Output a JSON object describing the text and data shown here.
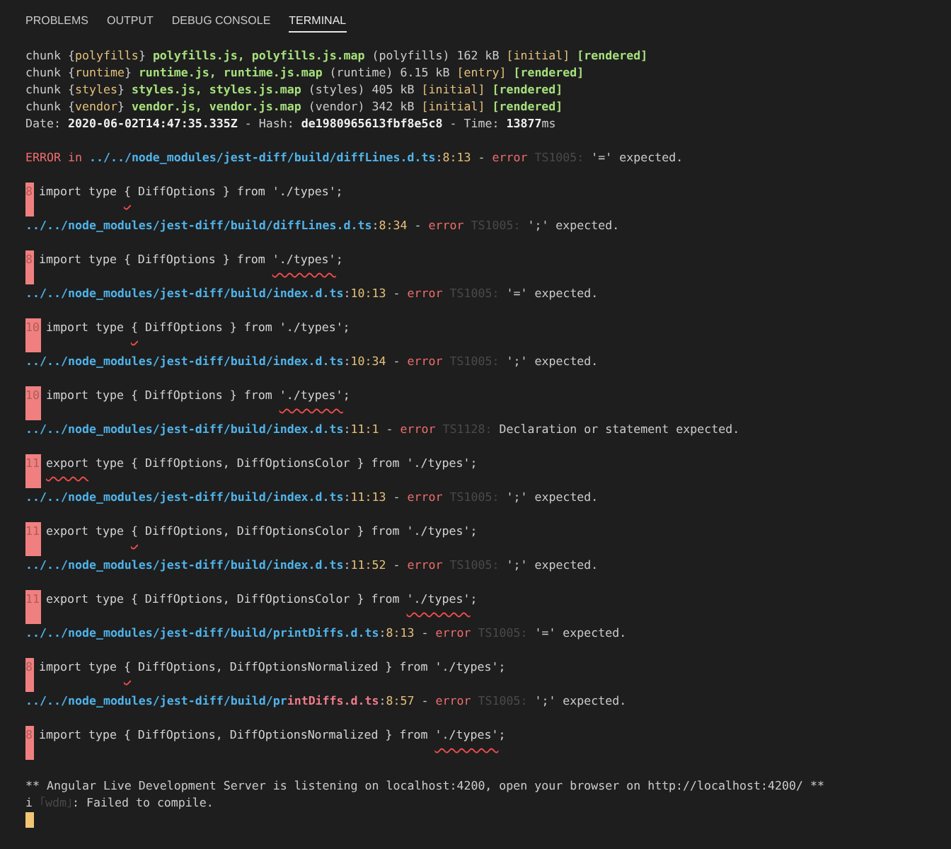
{
  "panel_tabs": [
    {
      "label": "PROBLEMS",
      "selected": false
    },
    {
      "label": "OUTPUT",
      "selected": false
    },
    {
      "label": "DEBUG CONSOLE",
      "selected": false
    },
    {
      "label": "TERMINAL",
      "selected": true
    }
  ],
  "terminal": {
    "lines": [
      {
        "kind": "text",
        "segments": [
          {
            "text": "chunk {",
            "kind": "normal"
          },
          {
            "text": "polyfills",
            "kind": "label"
          },
          {
            "text": "} ",
            "kind": "normal"
          },
          {
            "text": "polyfills.js, polyfills.js.map",
            "kind": "asset"
          },
          {
            "text": " (polyfills) 162 kB ",
            "kind": "normal"
          },
          {
            "text": "[initial] ",
            "kind": "label"
          },
          {
            "text": "[rendered]",
            "kind": "asset"
          }
        ]
      },
      {
        "kind": "text",
        "segments": [
          {
            "text": "chunk {",
            "kind": "normal"
          },
          {
            "text": "runtime",
            "kind": "label"
          },
          {
            "text": "} ",
            "kind": "normal"
          },
          {
            "text": "runtime.js, runtime.js.map",
            "kind": "asset"
          },
          {
            "text": " (runtime) 6.15 kB ",
            "kind": "normal"
          },
          {
            "text": "[entry] ",
            "kind": "label"
          },
          {
            "text": "[rendered]",
            "kind": "asset"
          }
        ]
      },
      {
        "kind": "text",
        "segments": [
          {
            "text": "chunk {",
            "kind": "normal"
          },
          {
            "text": "styles",
            "kind": "label"
          },
          {
            "text": "} ",
            "kind": "normal"
          },
          {
            "text": "styles.js, styles.js.map",
            "kind": "asset"
          },
          {
            "text": " (styles) 405 kB ",
            "kind": "normal"
          },
          {
            "text": "[initial] ",
            "kind": "label"
          },
          {
            "text": "[rendered]",
            "kind": "asset"
          }
        ]
      },
      {
        "kind": "text",
        "segments": [
          {
            "text": "chunk {",
            "kind": "normal"
          },
          {
            "text": "vendor",
            "kind": "label"
          },
          {
            "text": "} ",
            "kind": "normal"
          },
          {
            "text": "vendor.js, vendor.js.map",
            "kind": "asset"
          },
          {
            "text": " (vendor) 342 kB ",
            "kind": "normal"
          },
          {
            "text": "[initial] ",
            "kind": "label"
          },
          {
            "text": "[rendered]",
            "kind": "asset"
          }
        ]
      },
      {
        "kind": "text",
        "segments": [
          {
            "text": "Date: ",
            "kind": "normal"
          },
          {
            "text": "2020-06-02T14:47:35.335Z",
            "kind": "value"
          },
          {
            "text": " - Hash: ",
            "kind": "normal"
          },
          {
            "text": "de1980965613fbf8e5c8",
            "kind": "value"
          },
          {
            "text": " - Time: ",
            "kind": "normal"
          },
          {
            "text": "13877",
            "kind": "value"
          },
          {
            "text": "ms",
            "kind": "normal"
          }
        ]
      },
      {
        "kind": "blank"
      },
      {
        "kind": "text",
        "segments": [
          {
            "text": "ERROR in ",
            "kind": "error"
          },
          {
            "text": "../../node_modules/jest-diff/build/diffLines.d.ts",
            "kind": "path"
          },
          {
            "text": ":",
            "kind": "normal"
          },
          {
            "text": "8:13",
            "kind": "label"
          },
          {
            "text": " - ",
            "kind": "normal"
          },
          {
            "text": "error",
            "kind": "error"
          },
          {
            "text": " TS1005: ",
            "kind": "code"
          },
          {
            "text": "'=' expected.",
            "kind": "normal"
          }
        ]
      },
      {
        "kind": "blank"
      },
      {
        "kind": "code",
        "line_number": "8",
        "segments": [
          {
            "text": "import type ",
            "squiggle": false
          },
          {
            "text": "{",
            "squiggle": true
          },
          {
            "text": " DiffOptions } from './types';",
            "squiggle": false
          }
        ]
      },
      {
        "kind": "text",
        "segments": [
          {
            "text": "../../node_modules/jest-diff/build/diffLines.d.ts",
            "kind": "path"
          },
          {
            "text": ":",
            "kind": "normal"
          },
          {
            "text": "8:34",
            "kind": "label"
          },
          {
            "text": " - ",
            "kind": "normal"
          },
          {
            "text": "error",
            "kind": "error"
          },
          {
            "text": " TS1005: ",
            "kind": "code"
          },
          {
            "text": "';' expected.",
            "kind": "normal"
          }
        ]
      },
      {
        "kind": "blank"
      },
      {
        "kind": "code",
        "line_number": "8",
        "segments": [
          {
            "text": "import type { DiffOptions } from ",
            "squiggle": false
          },
          {
            "text": "'./types'",
            "squiggle": true
          },
          {
            "text": ";",
            "squiggle": false
          }
        ]
      },
      {
        "kind": "text",
        "segments": [
          {
            "text": "../../node_modules/jest-diff/build/index.d.ts",
            "kind": "path"
          },
          {
            "text": ":",
            "kind": "normal"
          },
          {
            "text": "10:13",
            "kind": "label"
          },
          {
            "text": " - ",
            "kind": "normal"
          },
          {
            "text": "error",
            "kind": "error"
          },
          {
            "text": " TS1005: ",
            "kind": "code"
          },
          {
            "text": "'=' expected.",
            "kind": "normal"
          }
        ]
      },
      {
        "kind": "blank"
      },
      {
        "kind": "code",
        "line_number": "10",
        "segments": [
          {
            "text": "import type ",
            "squiggle": false
          },
          {
            "text": "{",
            "squiggle": true
          },
          {
            "text": " DiffOptions } from './types';",
            "squiggle": false
          }
        ]
      },
      {
        "kind": "text",
        "segments": [
          {
            "text": "../../node_modules/jest-diff/build/index.d.ts",
            "kind": "path"
          },
          {
            "text": ":",
            "kind": "normal"
          },
          {
            "text": "10:34",
            "kind": "label"
          },
          {
            "text": " - ",
            "kind": "normal"
          },
          {
            "text": "error",
            "kind": "error"
          },
          {
            "text": " TS1005: ",
            "kind": "code"
          },
          {
            "text": "';' expected.",
            "kind": "normal"
          }
        ]
      },
      {
        "kind": "blank"
      },
      {
        "kind": "code",
        "line_number": "10",
        "segments": [
          {
            "text": "import type { DiffOptions } from ",
            "squiggle": false
          },
          {
            "text": "'./types'",
            "squiggle": true
          },
          {
            "text": ";",
            "squiggle": false
          }
        ]
      },
      {
        "kind": "text",
        "segments": [
          {
            "text": "../../node_modules/jest-diff/build/index.d.ts",
            "kind": "path"
          },
          {
            "text": ":",
            "kind": "normal"
          },
          {
            "text": "11:1",
            "kind": "label"
          },
          {
            "text": " - ",
            "kind": "normal"
          },
          {
            "text": "error",
            "kind": "error"
          },
          {
            "text": " TS1128: ",
            "kind": "code"
          },
          {
            "text": "Declaration or statement expected.",
            "kind": "normal"
          }
        ]
      },
      {
        "kind": "blank"
      },
      {
        "kind": "code",
        "line_number": "11",
        "segments": [
          {
            "text": "export",
            "squiggle": true
          },
          {
            "text": " type { DiffOptions, DiffOptionsColor } from './types';",
            "squiggle": false
          }
        ]
      },
      {
        "kind": "text",
        "segments": [
          {
            "text": "../../node_modules/jest-diff/build/index.d.ts",
            "kind": "path"
          },
          {
            "text": ":",
            "kind": "normal"
          },
          {
            "text": "11:13",
            "kind": "label"
          },
          {
            "text": " - ",
            "kind": "normal"
          },
          {
            "text": "error",
            "kind": "error"
          },
          {
            "text": " TS1005: ",
            "kind": "code"
          },
          {
            "text": "';' expected.",
            "kind": "normal"
          }
        ]
      },
      {
        "kind": "blank"
      },
      {
        "kind": "code",
        "line_number": "11",
        "segments": [
          {
            "text": "export type ",
            "squiggle": false
          },
          {
            "text": "{",
            "squiggle": true
          },
          {
            "text": " DiffOptions, DiffOptionsColor } from './types';",
            "squiggle": false
          }
        ]
      },
      {
        "kind": "text",
        "segments": [
          {
            "text": "../../node_modules/jest-diff/build/index.d.ts",
            "kind": "path"
          },
          {
            "text": ":",
            "kind": "normal"
          },
          {
            "text": "11:52",
            "kind": "label"
          },
          {
            "text": " - ",
            "kind": "normal"
          },
          {
            "text": "error",
            "kind": "error"
          },
          {
            "text": " TS1005: ",
            "kind": "code"
          },
          {
            "text": "';' expected.",
            "kind": "normal"
          }
        ]
      },
      {
        "kind": "blank"
      },
      {
        "kind": "code",
        "line_number": "11",
        "segments": [
          {
            "text": "export type { DiffOptions, DiffOptionsColor } from ",
            "squiggle": false
          },
          {
            "text": "'./types'",
            "squiggle": true
          },
          {
            "text": ";",
            "squiggle": false
          }
        ]
      },
      {
        "kind": "text",
        "segments": [
          {
            "text": "../../node_modules/jest-diff/build/printDiffs.d.ts",
            "kind": "path"
          },
          {
            "text": ":",
            "kind": "normal"
          },
          {
            "text": "8:13",
            "kind": "label"
          },
          {
            "text": " - ",
            "kind": "normal"
          },
          {
            "text": "error",
            "kind": "error"
          },
          {
            "text": " TS1005: ",
            "kind": "code"
          },
          {
            "text": "'=' expected.",
            "kind": "normal"
          }
        ]
      },
      {
        "kind": "blank"
      },
      {
        "kind": "code",
        "line_number": "8",
        "segments": [
          {
            "text": "import type ",
            "squiggle": false
          },
          {
            "text": "{",
            "squiggle": true
          },
          {
            "text": " DiffOptions, DiffOptionsNormalized } from './types';",
            "squiggle": false
          }
        ]
      },
      {
        "kind": "text",
        "segments": [
          {
            "text": "../../node_modules/jest-diff/build/pr",
            "kind": "path"
          },
          {
            "text": "intDiffs.d.ts",
            "kind": "path_end"
          },
          {
            "text": ":",
            "kind": "normal"
          },
          {
            "text": "8:57",
            "kind": "label"
          },
          {
            "text": " - ",
            "kind": "normal"
          },
          {
            "text": "error",
            "kind": "error"
          },
          {
            "text": " TS1005: ",
            "kind": "code"
          },
          {
            "text": "';' expected.",
            "kind": "normal"
          }
        ]
      },
      {
        "kind": "blank"
      },
      {
        "kind": "code",
        "line_number": "8",
        "segments": [
          {
            "text": "import type { DiffOptions, DiffOptionsNormalized } from ",
            "squiggle": false
          },
          {
            "text": "'./types'",
            "squiggle": true
          },
          {
            "text": ";",
            "squiggle": false
          }
        ]
      },
      {
        "kind": "blank"
      },
      {
        "kind": "text",
        "segments": [
          {
            "text": "** Angular Live Development Server is listening on localhost:4200, open your browser on http://localhost:4200/ **",
            "kind": "normal"
          }
        ]
      },
      {
        "kind": "text",
        "segments": [
          {
            "text": "i ",
            "kind": "normal"
          },
          {
            "text": "｢wdm｣",
            "kind": "code"
          },
          {
            "text": ": Failed to compile.",
            "kind": "normal"
          }
        ]
      },
      {
        "kind": "cursor"
      }
    ]
  }
}
